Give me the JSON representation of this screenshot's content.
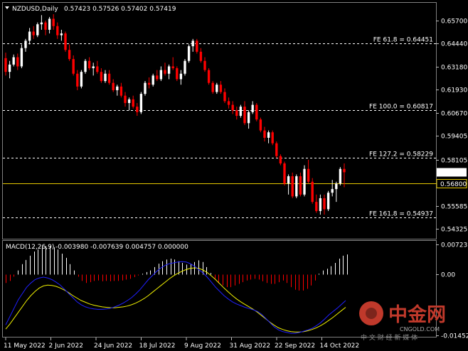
{
  "header": {
    "symbol": "NZDUSD,Daily",
    "ohlc": "0.57423 0.57526 0.57402 0.57419"
  },
  "macd_header": {
    "label": "MACD(12,26,9)",
    "values": "-0.003980 -0.007639 0.004757 0.000000"
  },
  "watermark": {
    "brand": "中金网",
    "site": "CNGOLD.COM",
    "tagline": "中 文 财 经 新 媒 体"
  },
  "colors": {
    "background": "#000000",
    "bull": "#ffffff",
    "bear": "#ff0000",
    "grid": "#ffffff",
    "support": "#e6c800",
    "macd_line": "#2020ff",
    "signal_line": "#f0f000",
    "hist_pos": "#ffffff",
    "hist_neg": "#ff0000"
  },
  "chart_data": [
    {
      "type": "candlestick",
      "title": "NZDUSD,Daily",
      "y_ticks": [
        "0.65700",
        "0.64440",
        "0.63180",
        "0.61930",
        "0.60670",
        "0.59405",
        "0.58105",
        "0.56830",
        "0.55585",
        "0.54325"
      ],
      "ylim": [
        0.5402,
        0.6605
      ],
      "x_ticks": [
        "11 May 2022",
        "2 Jun 2022",
        "24 Jun 2022",
        "18 Jul 2022",
        "9 Aug 2022",
        "31 Aug 2022",
        "22 Sep 2022",
        "14 Oct 2022"
      ],
      "last_price": "0.57419",
      "fib_levels": [
        {
          "label": "FE 61.8 = 0.64451",
          "value": 0.64451
        },
        {
          "label": "FE 100.0 = 0.60817",
          "value": 0.60817
        },
        {
          "label": "FE 127.2 = 0.58229",
          "value": 0.58229
        },
        {
          "label": "FE 161.8 = 0.54937",
          "value": 0.54937
        }
      ],
      "support": {
        "label": "0.56800",
        "value": 0.568
      },
      "candles": [
        [
          0.6365,
          0.6395,
          0.627,
          0.629
        ],
        [
          0.629,
          0.635,
          0.6255,
          0.633
        ],
        [
          0.633,
          0.6385,
          0.632,
          0.637
        ],
        [
          0.637,
          0.639,
          0.63,
          0.632
        ],
        [
          0.632,
          0.644,
          0.631,
          0.642
        ],
        [
          0.642,
          0.647,
          0.64,
          0.646
        ],
        [
          0.646,
          0.653,
          0.644,
          0.651
        ],
        [
          0.651,
          0.654,
          0.647,
          0.649
        ],
        [
          0.649,
          0.656,
          0.648,
          0.655
        ],
        [
          0.655,
          0.66,
          0.652,
          0.656
        ],
        [
          0.656,
          0.657,
          0.649,
          0.652
        ],
        [
          0.652,
          0.659,
          0.65,
          0.658
        ],
        [
          0.658,
          0.6605,
          0.652,
          0.654
        ],
        [
          0.654,
          0.656,
          0.647,
          0.649
        ],
        [
          0.649,
          0.652,
          0.646,
          0.65
        ],
        [
          0.65,
          0.651,
          0.64,
          0.641
        ],
        [
          0.641,
          0.644,
          0.635,
          0.636
        ],
        [
          0.636,
          0.638,
          0.627,
          0.628
        ],
        [
          0.628,
          0.63,
          0.619,
          0.621
        ],
        [
          0.621,
          0.63,
          0.62,
          0.629
        ],
        [
          0.629,
          0.636,
          0.628,
          0.635
        ],
        [
          0.635,
          0.637,
          0.63,
          0.631
        ],
        [
          0.631,
          0.634,
          0.627,
          0.632
        ],
        [
          0.632,
          0.635,
          0.628,
          0.629
        ],
        [
          0.629,
          0.631,
          0.623,
          0.624
        ],
        [
          0.624,
          0.63,
          0.623,
          0.628
        ],
        [
          0.628,
          0.63,
          0.622,
          0.623
        ],
        [
          0.623,
          0.625,
          0.618,
          0.619
        ],
        [
          0.619,
          0.622,
          0.616,
          0.621
        ],
        [
          0.621,
          0.623,
          0.615,
          0.616
        ],
        [
          0.616,
          0.618,
          0.61,
          0.612
        ],
        [
          0.612,
          0.615,
          0.608,
          0.614
        ],
        [
          0.614,
          0.616,
          0.609,
          0.61
        ],
        [
          0.61,
          0.612,
          0.605,
          0.607
        ],
        [
          0.607,
          0.618,
          0.606,
          0.617
        ],
        [
          0.617,
          0.624,
          0.616,
          0.623
        ],
        [
          0.623,
          0.626,
          0.62,
          0.622
        ],
        [
          0.622,
          0.628,
          0.621,
          0.627
        ],
        [
          0.627,
          0.63,
          0.624,
          0.625
        ],
        [
          0.625,
          0.632,
          0.624,
          0.63
        ],
        [
          0.63,
          0.634,
          0.627,
          0.628
        ],
        [
          0.628,
          0.633,
          0.625,
          0.632
        ],
        [
          0.632,
          0.637,
          0.63,
          0.631
        ],
        [
          0.631,
          0.632,
          0.624,
          0.625
        ],
        [
          0.625,
          0.63,
          0.622,
          0.628
        ],
        [
          0.628,
          0.636,
          0.627,
          0.635
        ],
        [
          0.635,
          0.644,
          0.634,
          0.643
        ],
        [
          0.643,
          0.647,
          0.64,
          0.646
        ],
        [
          0.646,
          0.647,
          0.639,
          0.64
        ],
        [
          0.64,
          0.642,
          0.634,
          0.635
        ],
        [
          0.635,
          0.637,
          0.629,
          0.63
        ],
        [
          0.63,
          0.631,
          0.622,
          0.623
        ],
        [
          0.623,
          0.624,
          0.617,
          0.618
        ],
        [
          0.618,
          0.623,
          0.617,
          0.622
        ],
        [
          0.622,
          0.624,
          0.617,
          0.618
        ],
        [
          0.618,
          0.62,
          0.612,
          0.613
        ],
        [
          0.613,
          0.615,
          0.609,
          0.611
        ],
        [
          0.611,
          0.613,
          0.606,
          0.608
        ],
        [
          0.608,
          0.61,
          0.603,
          0.605
        ],
        [
          0.605,
          0.611,
          0.604,
          0.61
        ],
        [
          0.61,
          0.613,
          0.6,
          0.601
        ],
        [
          0.601,
          0.608,
          0.598,
          0.607
        ],
        [
          0.607,
          0.613,
          0.606,
          0.611
        ],
        [
          0.611,
          0.612,
          0.602,
          0.603
        ],
        [
          0.603,
          0.604,
          0.596,
          0.597
        ],
        [
          0.597,
          0.599,
          0.591,
          0.593
        ],
        [
          0.593,
          0.597,
          0.59,
          0.596
        ],
        [
          0.596,
          0.597,
          0.589,
          0.59
        ],
        [
          0.59,
          0.591,
          0.582,
          0.583
        ],
        [
          0.583,
          0.584,
          0.578,
          0.579
        ],
        [
          0.579,
          0.58,
          0.567,
          0.568
        ],
        [
          0.568,
          0.573,
          0.562,
          0.572
        ],
        [
          0.572,
          0.574,
          0.56,
          0.561
        ],
        [
          0.561,
          0.573,
          0.56,
          0.572
        ],
        [
          0.572,
          0.574,
          0.561,
          0.562
        ],
        [
          0.562,
          0.578,
          0.561,
          0.576
        ],
        [
          0.576,
          0.581,
          0.568,
          0.569
        ],
        [
          0.569,
          0.571,
          0.557,
          0.558
        ],
        [
          0.558,
          0.562,
          0.552,
          0.553
        ],
        [
          0.553,
          0.562,
          0.551,
          0.56
        ],
        [
          0.56,
          0.562,
          0.551,
          0.554
        ],
        [
          0.554,
          0.564,
          0.553,
          0.563
        ],
        [
          0.563,
          0.57,
          0.561,
          0.565
        ],
        [
          0.565,
          0.569,
          0.558,
          0.568
        ],
        [
          0.568,
          0.577,
          0.567,
          0.576
        ],
        [
          0.576,
          0.579,
          0.566,
          0.5742
        ]
      ]
    },
    {
      "type": "macd",
      "title": "MACD(12,26,9)",
      "y_ticks": [
        "0.007237",
        "0.00",
        "-0.014529"
      ],
      "ylim": [
        -0.0145,
        0.0072
      ],
      "histogram": [
        -0.002,
        -0.0015,
        -0.0005,
        0.001,
        0.0025,
        0.0035,
        0.0045,
        0.0055,
        0.006,
        0.0065,
        0.0068,
        0.0068,
        0.0065,
        0.006,
        0.005,
        0.004,
        0.0025,
        0.001,
        -0.0005,
        -0.0015,
        -0.002,
        -0.0018,
        -0.0015,
        -0.0014,
        -0.0016,
        -0.0015,
        -0.0016,
        -0.0015,
        -0.0015,
        -0.0014,
        -0.0012,
        -0.001,
        -0.0006,
        -0.0002,
        0.0002,
        0.0006,
        0.001,
        0.0018,
        0.0026,
        0.0032,
        0.0036,
        0.0038,
        0.0036,
        0.0032,
        0.0028,
        0.0024,
        0.0026,
        0.003,
        0.0034,
        0.003,
        0.0018,
        0.0004,
        -0.001,
        -0.002,
        -0.0026,
        -0.003,
        -0.003,
        -0.0026,
        -0.0022,
        -0.0018,
        -0.0014,
        -0.0012,
        -0.001,
        -0.0012,
        -0.0016,
        -0.002,
        -0.0022,
        -0.0022,
        -0.0018,
        -0.0014,
        -0.002,
        -0.003,
        -0.0036,
        -0.0038,
        -0.0038,
        -0.0034,
        -0.0026,
        -0.0014,
        0.0002,
        0.001,
        0.0014,
        0.002,
        0.0028,
        0.0038,
        0.0045,
        0.0048
      ],
      "macd": [
        -0.012,
        -0.01,
        -0.008,
        -0.006,
        -0.0045,
        -0.003,
        -0.002,
        -0.0012,
        -0.0008,
        -0.0006,
        -0.0008,
        -0.0012,
        -0.0018,
        -0.0025,
        -0.0035,
        -0.0045,
        -0.0055,
        -0.0065,
        -0.0072,
        -0.0077,
        -0.008,
        -0.0082,
        -0.0083,
        -0.0083,
        -0.0082,
        -0.008,
        -0.0077,
        -0.0073,
        -0.0068,
        -0.0062,
        -0.0055,
        -0.0046,
        -0.0036,
        -0.0024,
        -0.0012,
        -0.0002,
        0.0008,
        0.0016,
        0.0022,
        0.0026,
        0.0028,
        0.003,
        0.0031,
        0.003,
        0.0026,
        0.002,
        0.0012,
        0.0004,
        -0.0006,
        -0.0018,
        -0.003,
        -0.004,
        -0.005,
        -0.0058,
        -0.0065,
        -0.007,
        -0.0074,
        -0.0078,
        -0.0081,
        -0.0084,
        -0.0088,
        -0.0095,
        -0.0105,
        -0.0115,
        -0.0125,
        -0.0132,
        -0.0136,
        -0.0138,
        -0.014,
        -0.014,
        -0.0138,
        -0.0135,
        -0.0132,
        -0.0128,
        -0.0122,
        -0.0115,
        -0.0106,
        -0.0096,
        -0.0088,
        -0.008,
        -0.0071,
        -0.0062
      ],
      "signal": [
        -0.013,
        -0.0118,
        -0.0104,
        -0.009,
        -0.0076,
        -0.0062,
        -0.005,
        -0.004,
        -0.0032,
        -0.0027,
        -0.0025,
        -0.0026,
        -0.0028,
        -0.0032,
        -0.0037,
        -0.0043,
        -0.005,
        -0.0056,
        -0.0062,
        -0.0066,
        -0.007,
        -0.0073,
        -0.0075,
        -0.0077,
        -0.0078,
        -0.0079,
        -0.0079,
        -0.0078,
        -0.0077,
        -0.0075,
        -0.0072,
        -0.0068,
        -0.0063,
        -0.0057,
        -0.005,
        -0.0042,
        -0.0034,
        -0.0026,
        -0.0018,
        -0.001,
        -0.0003,
        0.0003,
        0.0008,
        0.0012,
        0.0015,
        0.0016,
        0.0015,
        0.0011,
        0.0005,
        -0.0003,
        -0.0012,
        -0.0022,
        -0.0032,
        -0.0041,
        -0.005,
        -0.0058,
        -0.0065,
        -0.0071,
        -0.0077,
        -0.0083,
        -0.009,
        -0.0098,
        -0.0106,
        -0.0114,
        -0.0121,
        -0.0127,
        -0.0131,
        -0.0134,
        -0.0136,
        -0.0137,
        -0.0137,
        -0.0136,
        -0.0134,
        -0.0131,
        -0.0127,
        -0.0122,
        -0.0116,
        -0.0109,
        -0.0102,
        -0.0094,
        -0.0086,
        -0.0078
      ]
    }
  ]
}
